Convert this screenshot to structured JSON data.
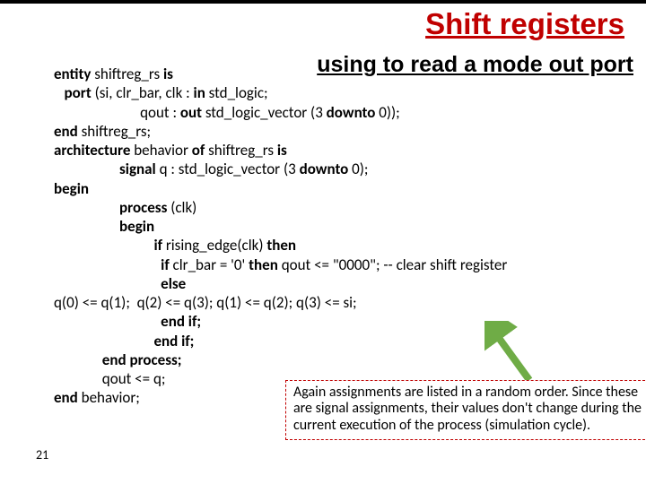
{
  "title": "Shift registers",
  "subtitle": "using to read a mode out port",
  "code": {
    "l1a": "entity",
    "l1b": " shiftreg_rs ",
    "l1c": "is",
    "l2a": "   port",
    "l2b": " (si, clr_bar, clk : ",
    "l2c": "in",
    "l2d": " std_logic;",
    "l3a": "                         qout : ",
    "l3b": "out",
    "l3c": " std_logic_vector (3 ",
    "l3d": "downto",
    "l3e": " 0));",
    "l4a": "end",
    "l4b": " shiftreg_rs;",
    "l5a": "architecture",
    "l5b": " behavior ",
    "l5c": "of",
    "l5d": " shiftreg_rs ",
    "l5e": "is",
    "l6a": "                   signal",
    "l6b": " q : std_logic_vector (3 ",
    "l6c": "downto",
    "l6d": " 0);",
    "l7": "begin",
    "l8a": "                   process",
    "l8b": " (clk)",
    "l9": "                   begin",
    "l10a": "                             if",
    "l10b": " rising_edge(clk) ",
    "l10c": "then",
    "l11a": "                               if",
    "l11b": " clr_bar = '0' ",
    "l11c": "then",
    "l11d": " qout <= \"0000\"; -- clear shift register",
    "l12": "                               else",
    "l13": "q(0) <= q(1);  q(2) <= q(3); q(1) <= q(2); q(3) <= si;",
    "l14": "                               end if;",
    "l15": "                             end if;",
    "l16": "              end process;",
    "l17": "              qout <= q;",
    "l18a": "end",
    "l18b": " behavior;"
  },
  "note": "Again assignments are listed in a random order. Since these are signal assignments, their values don't change during the current execution of the process (simulation cycle).",
  "pagenum": "21"
}
